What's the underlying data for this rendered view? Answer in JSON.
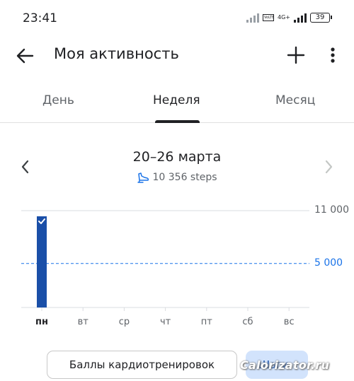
{
  "status_bar": {
    "time": "23:41",
    "network_badge": "VoLTE",
    "network_type": "4G+",
    "battery": "39"
  },
  "app_bar": {
    "title": "Моя активность",
    "back_icon": "arrow-back-icon",
    "add_icon": "plus-icon",
    "more_icon": "more-vertical-icon"
  },
  "tabs": [
    {
      "label": "День",
      "active": false
    },
    {
      "label": "Неделя",
      "active": true
    },
    {
      "label": "Месяц",
      "active": false
    }
  ],
  "period": {
    "range": "20–26 марта",
    "steps_text": "10 356 steps",
    "steps_icon": "walking-shoe-icon",
    "prev_icon": "chevron-left-icon",
    "next_icon": "chevron-right-icon"
  },
  "chart_data": {
    "type": "bar",
    "categories": [
      "пн",
      "вт",
      "ср",
      "чт",
      "пт",
      "сб",
      "вс"
    ],
    "values": [
      10356,
      0,
      0,
      0,
      0,
      0,
      0
    ],
    "goal_reached": [
      true,
      false,
      false,
      false,
      false,
      false,
      false
    ],
    "y_ticks": [
      "11 000",
      "5 000"
    ],
    "ylim": [
      0,
      11000
    ],
    "goal_line": 5000,
    "today_index": 0,
    "bar_color": "#1a4fa8",
    "goal_color": "#1a73e8"
  },
  "chips": {
    "cardio": "Баллы кардиотренировок",
    "steps": "Шаги"
  },
  "watermark": "Calorizator.ru",
  "colors": {
    "accent": "#1a73e8",
    "bar": "#1a4fa8",
    "chip_active_bg": "#d2e3fc"
  }
}
